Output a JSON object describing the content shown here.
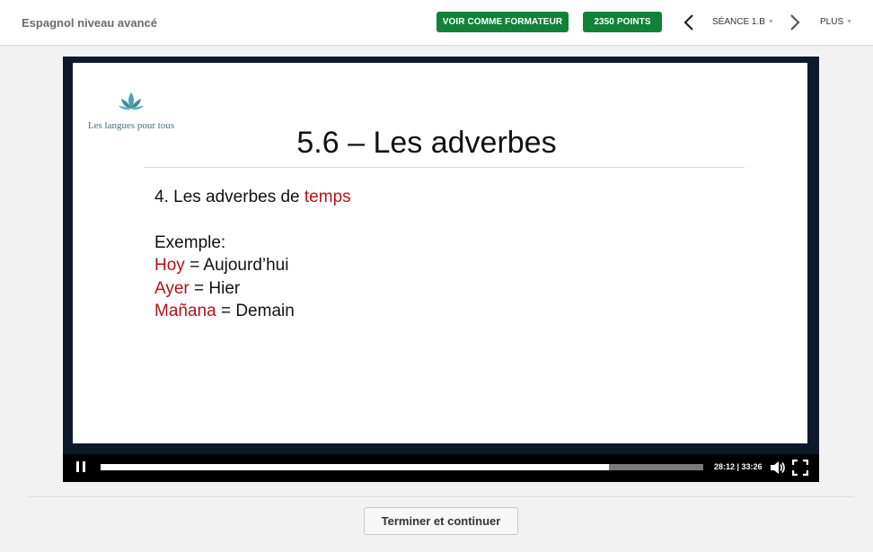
{
  "header": {
    "course_title": "Espagnol niveau avancé",
    "trainer_button": "VOIR COMME FORMATEUR",
    "points_button": "2350 POINTS",
    "session_label": "SÉANCE 1.B",
    "more_label": "PLUS",
    "button_color": "#12813a"
  },
  "slide": {
    "logo_text": "Les langues pour tous",
    "title": "5.6 – Les adverbes",
    "heading_prefix": "4. Les adverbes de ",
    "heading_highlight": "temps",
    "example_label": "Exemple:",
    "examples": [
      {
        "es": "Hoy",
        "sep": " = ",
        "fr": "Aujourd’hui"
      },
      {
        "es": "Ayer",
        "sep": " = ",
        "fr": "Hier"
      },
      {
        "es": "Mañana",
        "sep": " = ",
        "fr": "Demain"
      }
    ],
    "highlight_color": "#b01217"
  },
  "player": {
    "time_display": "28:12 | 33:26",
    "progress_fraction": 0.843,
    "state": "playing"
  },
  "footer": {
    "finish_button": "Terminer et continuer"
  }
}
